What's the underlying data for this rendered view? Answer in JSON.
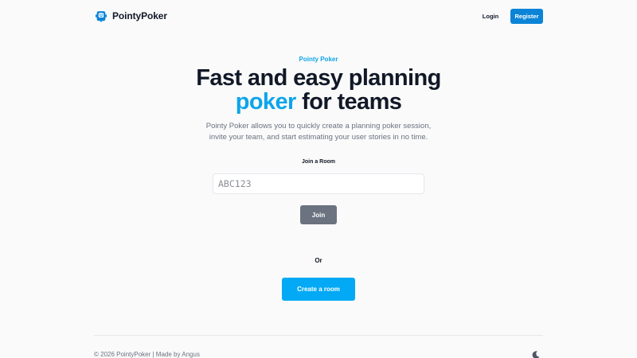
{
  "header": {
    "logo_text": "PointyPoker",
    "logo_icon": "poker-robot-icon",
    "login_label": "Login",
    "register_label": "Register",
    "brand_color": "#0b84d8"
  },
  "hero": {
    "eyebrow": "Pointy Poker",
    "headline_line1": "Fast and easy planning",
    "headline_accent": "poker",
    "headline_line2_rest": " for teams",
    "subtext": "Pointy Poker allows you to quickly create a planning poker session, invite your team, and start estimating your user stories in no time.",
    "accent_color": "#0ea5e9"
  },
  "join": {
    "label": "Join a Room",
    "placeholder": "ABC123",
    "value": "",
    "button_label": "Join"
  },
  "divider_label": "Or",
  "create": {
    "button_label": "Create a room",
    "button_color": "#03a9f4"
  },
  "footer": {
    "text": "© 2026 PointyPoker | Made by Angus",
    "theme_toggle_icon": "moon-icon"
  }
}
